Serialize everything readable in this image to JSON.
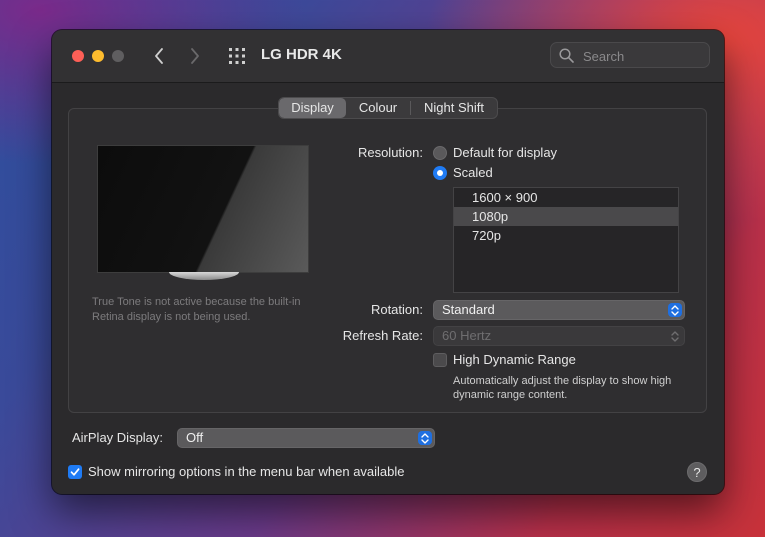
{
  "window": {
    "title": "LG HDR 4K"
  },
  "search": {
    "placeholder": "Search"
  },
  "tabs": [
    {
      "label": "Display",
      "active": true
    },
    {
      "label": "Colour",
      "active": false
    },
    {
      "label": "Night Shift",
      "active": false
    }
  ],
  "true_tone_note": "True Tone is not active because the built-in Retina display is not being used.",
  "resolution": {
    "label": "Resolution:",
    "options": [
      {
        "label": "Default for display",
        "selected": false
      },
      {
        "label": "Scaled",
        "selected": true
      }
    ],
    "scaled_list": [
      {
        "label": "1600 × 900",
        "selected": false
      },
      {
        "label": "1080p",
        "selected": true
      },
      {
        "label": "720p",
        "selected": false
      }
    ]
  },
  "rotation": {
    "label": "Rotation:",
    "value": "Standard"
  },
  "refresh_rate": {
    "label": "Refresh Rate:",
    "value": "60 Hertz",
    "enabled": false
  },
  "hdr": {
    "label": "High Dynamic Range",
    "checked": false,
    "description": "Automatically adjust the display to show high dynamic range content."
  },
  "airplay": {
    "label": "AirPlay Display:",
    "value": "Off"
  },
  "mirroring": {
    "label": "Show mirroring options in the menu bar when available",
    "checked": true
  },
  "help": {
    "label": "?"
  },
  "icons": {
    "back": "chevron-left-icon",
    "forward": "chevron-right-icon",
    "grid": "grid-icon",
    "search": "magnifier-icon",
    "help": "question-icon"
  },
  "colors": {
    "accent": "#1f7bf4",
    "window_bg": "#2b2a2c",
    "close": "#fe5f57",
    "minimize": "#febc2e"
  }
}
